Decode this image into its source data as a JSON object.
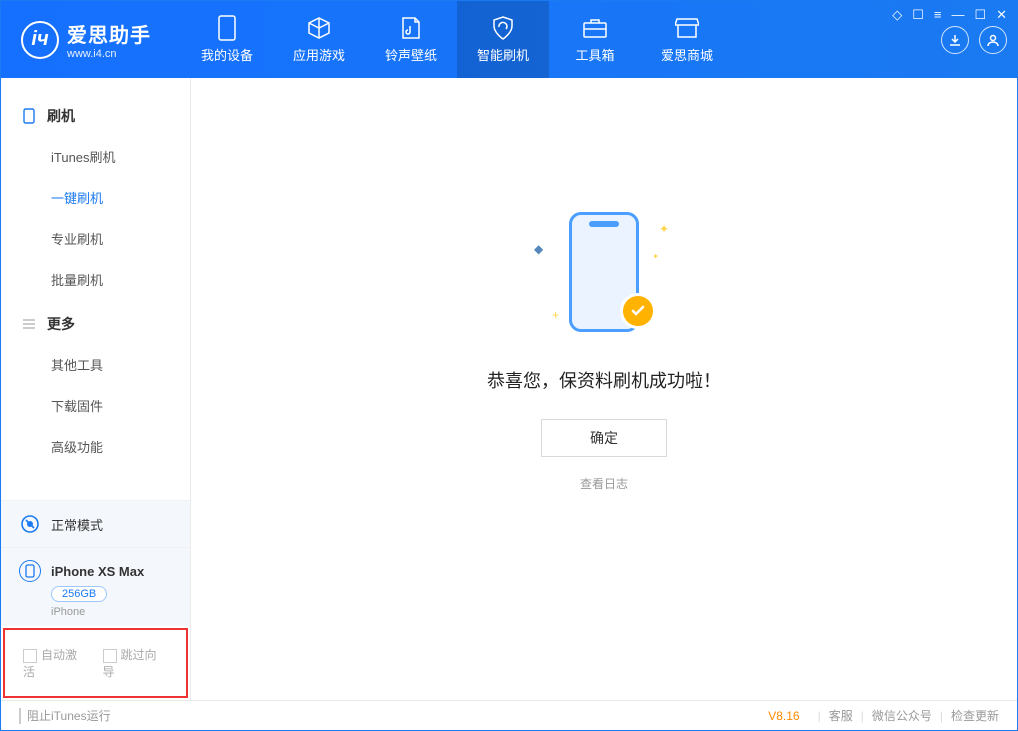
{
  "app": {
    "title": "爱思助手",
    "subtitle": "www.i4.cn"
  },
  "nav": {
    "items": [
      {
        "label": "我的设备"
      },
      {
        "label": "应用游戏"
      },
      {
        "label": "铃声壁纸"
      },
      {
        "label": "智能刷机"
      },
      {
        "label": "工具箱"
      },
      {
        "label": "爱思商城"
      }
    ]
  },
  "sidebar": {
    "group1": {
      "title": "刷机",
      "items": [
        {
          "label": "iTunes刷机"
        },
        {
          "label": "一键刷机"
        },
        {
          "label": "专业刷机"
        },
        {
          "label": "批量刷机"
        }
      ]
    },
    "group2": {
      "title": "更多",
      "items": [
        {
          "label": "其他工具"
        },
        {
          "label": "下载固件"
        },
        {
          "label": "高级功能"
        }
      ]
    },
    "mode_label": "正常模式",
    "device": {
      "name": "iPhone XS Max",
      "capacity": "256GB",
      "type": "iPhone"
    },
    "cb1": "自动激活",
    "cb2": "跳过向导"
  },
  "content": {
    "success_msg": "恭喜您，保资料刷机成功啦！",
    "ok_btn": "确定",
    "log_link": "查看日志"
  },
  "footer": {
    "block_itunes": "阻止iTunes运行",
    "version": "V8.16",
    "links": [
      "客服",
      "微信公众号",
      "检查更新"
    ]
  }
}
